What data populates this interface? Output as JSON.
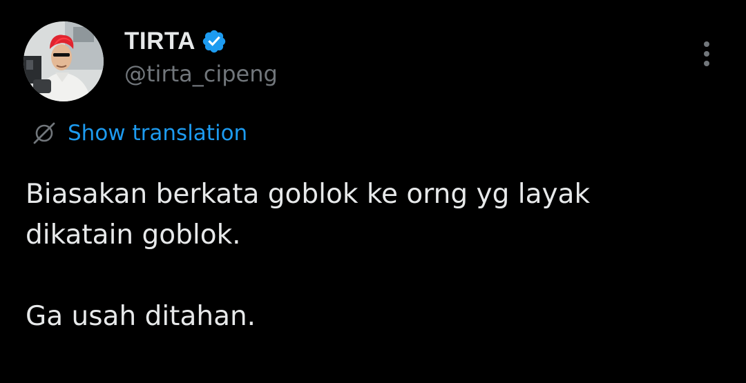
{
  "author": {
    "display_name": "TIRTA",
    "handle": "@tirta_cipeng",
    "verified": true
  },
  "translation": {
    "label": "Show translation"
  },
  "tweet": {
    "lines": [
      "Biasakan berkata goblok ke orng yg layak",
      "dikatain goblok.",
      "Ga usah ditahan."
    ]
  },
  "icons": {
    "verified": "verified-badge-icon",
    "translate": "globe-slash-icon",
    "more": "more-vertical-icon"
  },
  "colors": {
    "background": "#000000",
    "text": "#e7e9ea",
    "secondary": "#71767b",
    "accent": "#1d9bf0"
  }
}
